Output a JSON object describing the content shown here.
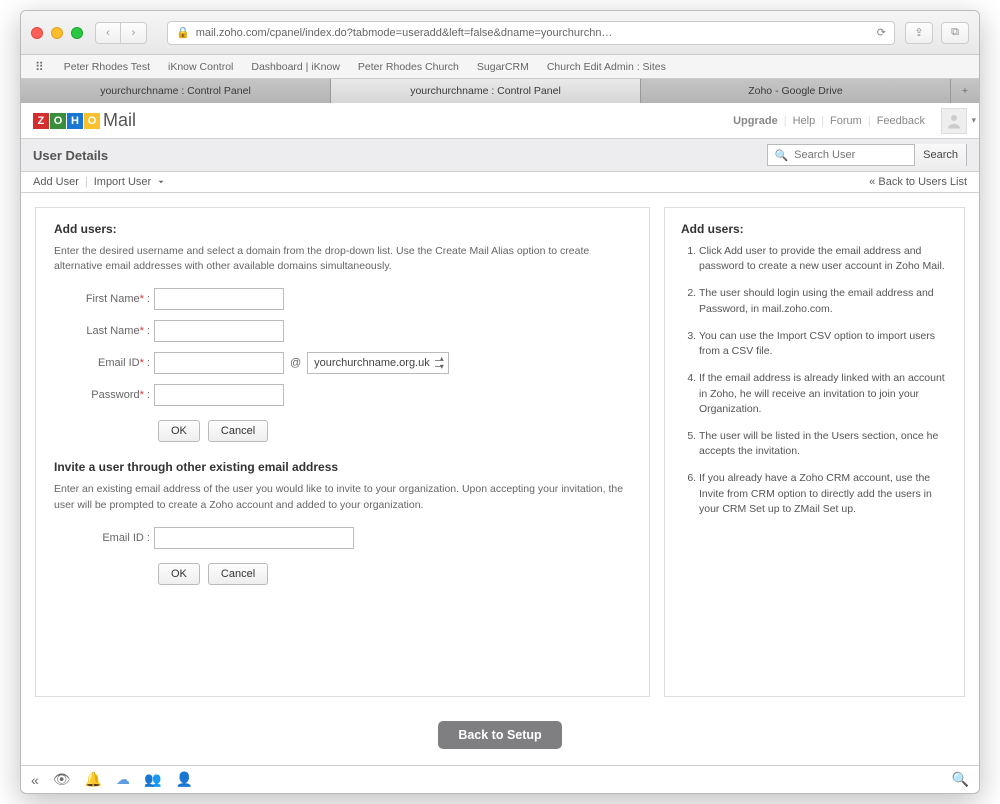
{
  "browser": {
    "url": "mail.zoho.com/cpanel/index.do?tabmode=useradd&left=false&dname=yourchurchn…",
    "bookmarks": [
      "Peter Rhodes Test",
      "iKnow Control",
      "Dashboard | iKnow",
      "Peter Rhodes Church",
      "SugarCRM",
      "Church Edit Admin : Sites"
    ],
    "tabs": [
      "yourchurchname : Control Panel",
      "yourchurchname : Control Panel",
      "Zoho - Google Drive"
    ],
    "active_tab": 1
  },
  "top_nav": {
    "logo_text": "Mail",
    "links": {
      "upgrade": "Upgrade",
      "help": "Help",
      "forum": "Forum",
      "feedback": "Feedback"
    }
  },
  "page_header": {
    "title": "User Details",
    "search_placeholder": "Search User",
    "search_button": "Search"
  },
  "actions": {
    "add_user": "Add User",
    "import_user": "Import User",
    "back": "Back to Users List"
  },
  "add_users": {
    "heading": "Add users:",
    "desc": "Enter the desired username and select a domain from the drop-down list. Use the Create Mail Alias option to create alternative email addresses with other available domains simultaneously.",
    "labels": {
      "first_name": "First Name",
      "last_name": "Last Name",
      "email_id": "Email ID",
      "password": "Password"
    },
    "domain": "yourchurchname.org.uk",
    "ok": "OK",
    "cancel": "Cancel"
  },
  "invite": {
    "heading": "Invite a user through other existing email address",
    "desc": "Enter an existing email address of the user you would like to invite to your organization. Upon accepting your invitation, the user will be prompted to create a Zoho account and added to your organization.",
    "label": "Email ID :",
    "ok": "OK",
    "cancel": "Cancel"
  },
  "sidebar": {
    "heading": "Add users:",
    "items": [
      "Click Add user to provide the email address and password to create a new user account in Zoho Mail.",
      "The user should login using the email address and Password, in mail.zoho.com.",
      "You can use the Import CSV option to import users from a CSV file.",
      "If the email address is already linked with an account in Zoho, he will receive an invitation to join your Organization.",
      "The user will be listed in the Users section, once he accepts the invitation.",
      "If you already have a Zoho CRM account, use the Invite from CRM option to directly add the users in your CRM Set up to ZMail Set up."
    ]
  },
  "back_setup": "Back to Setup"
}
